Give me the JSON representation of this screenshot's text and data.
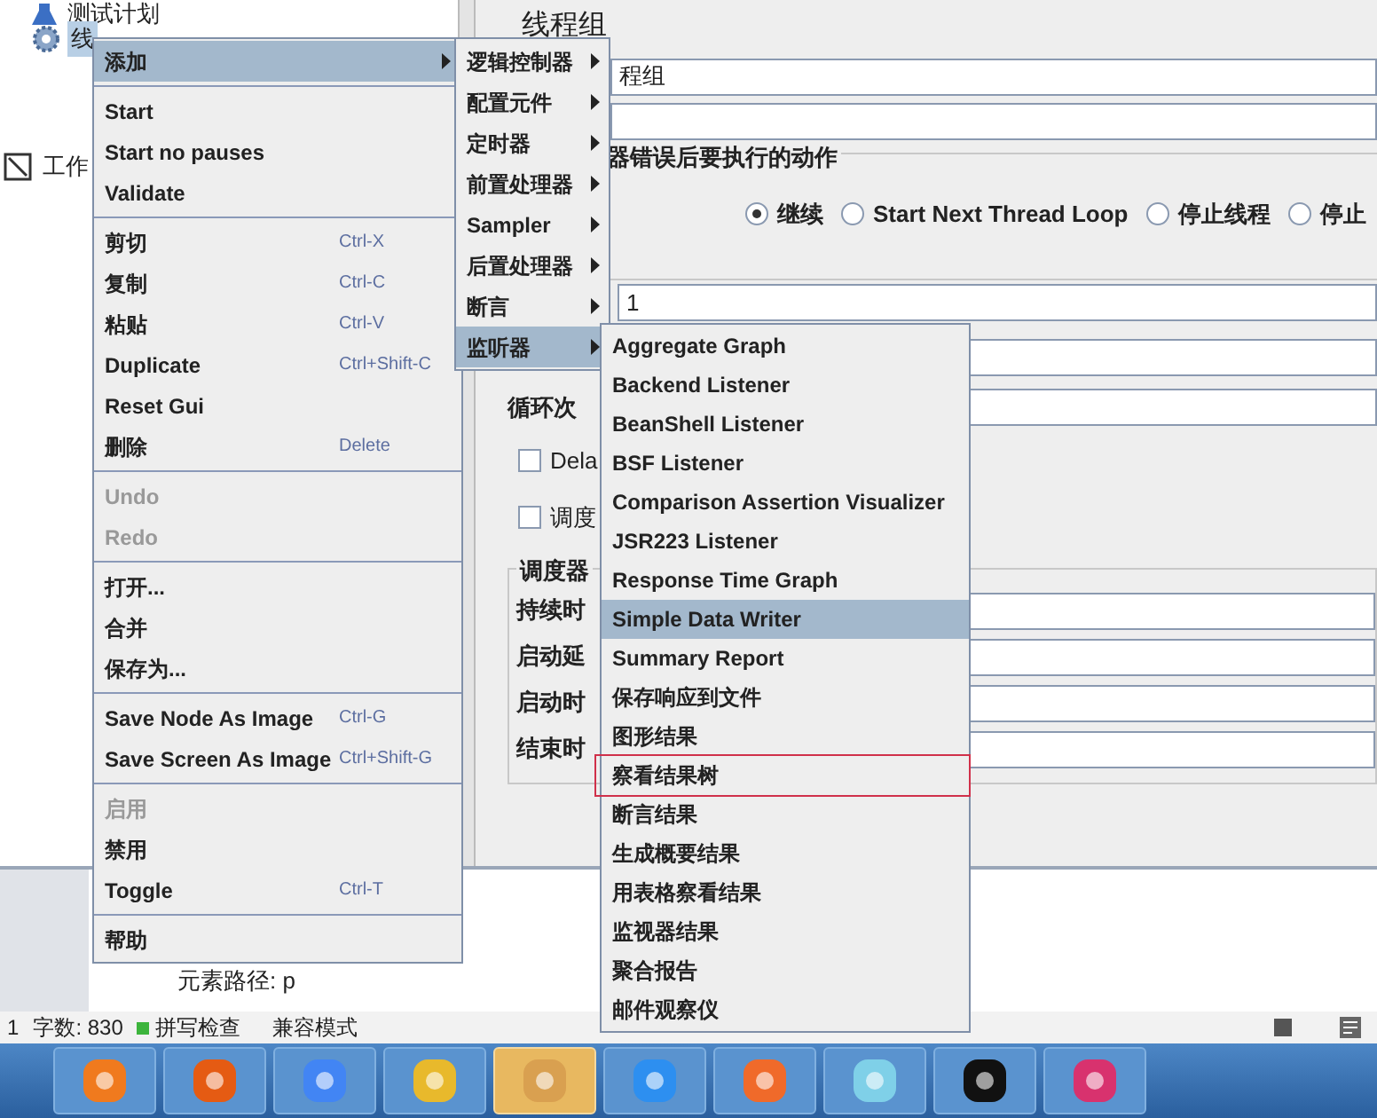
{
  "tree": {
    "items": [
      {
        "label": "测试计划",
        "selected": false
      },
      {
        "label": "线",
        "selected": true
      },
      {
        "label": "工作",
        "selected": false
      }
    ]
  },
  "panel": {
    "title": "线程组",
    "name_value": "程组",
    "error_group": {
      "legend": "器错误后要执行的动作",
      "options": [
        {
          "label": "继续",
          "selected": true
        },
        {
          "label": "Start Next Thread Loop",
          "selected": false
        },
        {
          "label": "停止线程",
          "selected": false
        },
        {
          "label": "停止",
          "selected": false
        }
      ]
    },
    "threads_value": "1",
    "loop_label": "循环次",
    "checkboxes": [
      {
        "label": "Dela",
        "checked": false
      },
      {
        "label": "调度",
        "checked": false
      }
    ],
    "scheduler": {
      "legend": "调度器",
      "rows": [
        "持续时",
        "启动延",
        "启动时",
        "结束时"
      ]
    }
  },
  "context_menu": {
    "items": [
      {
        "kind": "item",
        "label": "添加",
        "submenu": true,
        "selected": true
      },
      {
        "kind": "separator"
      },
      {
        "kind": "item",
        "label": "Start",
        "disabled": false
      },
      {
        "kind": "item",
        "label": "Start no pauses",
        "disabled": false
      },
      {
        "kind": "item",
        "label": "Validate",
        "disabled": false
      },
      {
        "kind": "separator"
      },
      {
        "kind": "item",
        "label": "剪切",
        "shortcut": "Ctrl-X",
        "disabled": false
      },
      {
        "kind": "item",
        "label": "复制",
        "shortcut": "Ctrl-C",
        "disabled": false
      },
      {
        "kind": "item",
        "label": "粘贴",
        "shortcut": "Ctrl-V",
        "disabled": false
      },
      {
        "kind": "item",
        "label": "Duplicate",
        "shortcut": "Ctrl+Shift-C",
        "disabled": false
      },
      {
        "kind": "item",
        "label": "Reset Gui",
        "disabled": false
      },
      {
        "kind": "item",
        "label": "删除",
        "shortcut": "Delete",
        "disabled": false
      },
      {
        "kind": "separator"
      },
      {
        "kind": "item",
        "label": "Undo",
        "disabled": true
      },
      {
        "kind": "item",
        "label": "Redo",
        "disabled": true
      },
      {
        "kind": "separator"
      },
      {
        "kind": "item",
        "label": "打开...",
        "disabled": false
      },
      {
        "kind": "item",
        "label": "合并",
        "disabled": false
      },
      {
        "kind": "item",
        "label": "保存为...",
        "disabled": false
      },
      {
        "kind": "separator"
      },
      {
        "kind": "item",
        "label": "Save Node As Image",
        "shortcut": "Ctrl-G",
        "disabled": false
      },
      {
        "kind": "item",
        "label": "Save Screen As Image",
        "shortcut": "Ctrl+Shift-G",
        "disabled": false
      },
      {
        "kind": "separator"
      },
      {
        "kind": "item",
        "label": "启用",
        "disabled": true
      },
      {
        "kind": "item",
        "label": "禁用",
        "disabled": false
      },
      {
        "kind": "item",
        "label": "Toggle",
        "shortcut": "Ctrl-T",
        "disabled": false
      },
      {
        "kind": "separator"
      },
      {
        "kind": "item",
        "label": "帮助",
        "disabled": false
      }
    ]
  },
  "add_submenu": {
    "items": [
      {
        "label": "逻辑控制器",
        "selected": false
      },
      {
        "label": "配置元件",
        "selected": false
      },
      {
        "label": "定时器",
        "selected": false
      },
      {
        "label": "前置处理器",
        "selected": false
      },
      {
        "label": "Sampler",
        "selected": false
      },
      {
        "label": "后置处理器",
        "selected": false
      },
      {
        "label": "断言",
        "selected": false
      },
      {
        "label": "监听器",
        "selected": true
      }
    ]
  },
  "listener_submenu": {
    "items": [
      {
        "label": "Aggregate Graph",
        "selected": false,
        "marked": false
      },
      {
        "label": "Backend Listener",
        "selected": false,
        "marked": false
      },
      {
        "label": "BeanShell Listener",
        "selected": false,
        "marked": false
      },
      {
        "label": "BSF Listener",
        "selected": false,
        "marked": false
      },
      {
        "label": "Comparison Assertion Visualizer",
        "selected": false,
        "marked": false
      },
      {
        "label": "JSR223 Listener",
        "selected": false,
        "marked": false
      },
      {
        "label": "Response Time Graph",
        "selected": false,
        "marked": false
      },
      {
        "label": "Simple Data Writer",
        "selected": true,
        "marked": false
      },
      {
        "label": "Summary Report",
        "selected": false,
        "marked": false
      },
      {
        "label": "保存响应到文件",
        "selected": false,
        "marked": false
      },
      {
        "label": "图形结果",
        "selected": false,
        "marked": false
      },
      {
        "label": "察看结果树",
        "selected": false,
        "marked": true
      },
      {
        "label": "断言结果",
        "selected": false,
        "marked": false
      },
      {
        "label": "生成概要结果",
        "selected": false,
        "marked": false
      },
      {
        "label": "用表格察看结果",
        "selected": false,
        "marked": false
      },
      {
        "label": "监视器结果",
        "selected": false,
        "marked": false
      },
      {
        "label": "聚合报告",
        "selected": false,
        "marked": false
      },
      {
        "label": "邮件观察仪",
        "selected": false,
        "marked": false
      }
    ]
  },
  "editor": {
    "element_path": "元素路径: p"
  },
  "status_bar": {
    "page": "1",
    "word_count": "字数: 830",
    "spell_check": "拼写检查",
    "mode": "兼容模式"
  },
  "taskbar": {
    "apps": [
      {
        "color": "#f07a1e",
        "selected": false
      },
      {
        "color": "#e55b13",
        "selected": false
      },
      {
        "color": "#4285f4",
        "selected": false
      },
      {
        "color": "#e8b92c",
        "selected": false
      },
      {
        "color": "#d9a050",
        "selected": true
      },
      {
        "color": "#2d8ff0",
        "selected": false
      },
      {
        "color": "#f06a2a",
        "selected": false
      },
      {
        "color": "#7fd0e8",
        "selected": false
      },
      {
        "color": "#111111",
        "selected": false
      },
      {
        "color": "#d8326e",
        "selected": false
      }
    ]
  }
}
